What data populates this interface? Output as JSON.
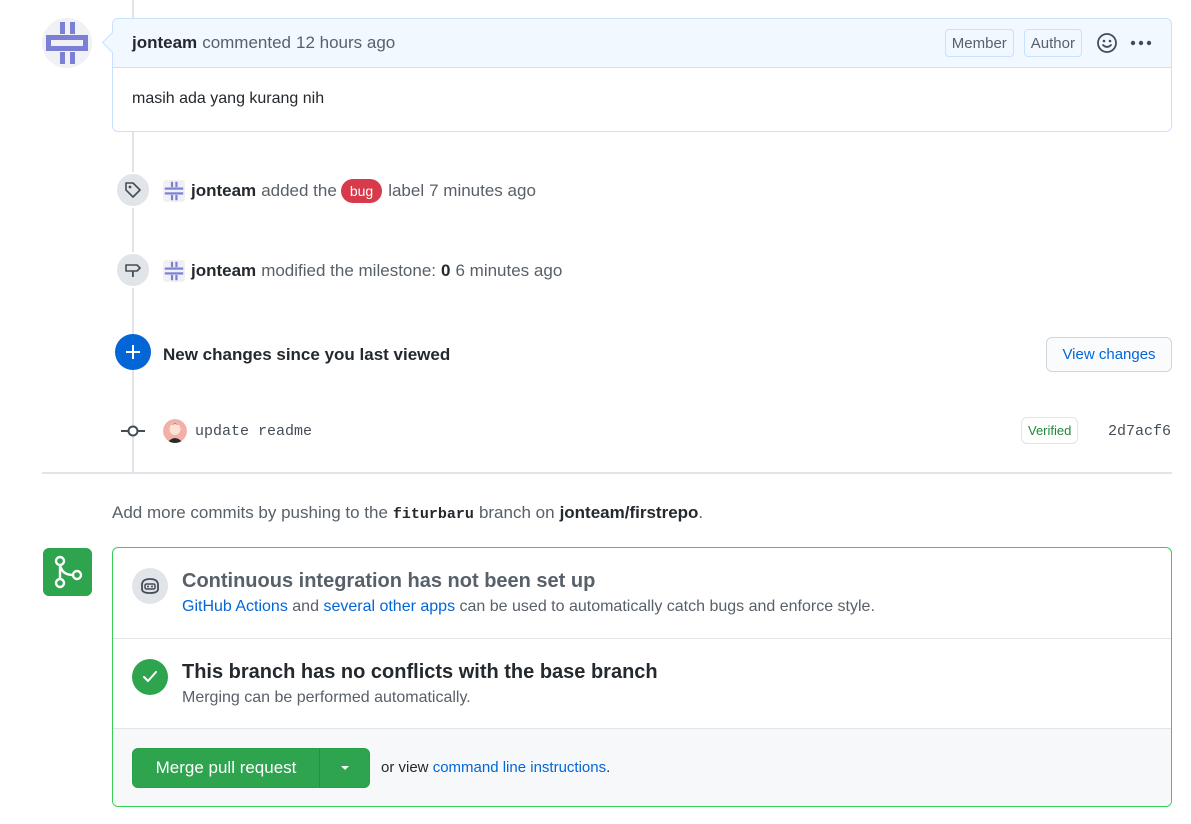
{
  "comment": {
    "author": "jonteam",
    "action": "commented",
    "time": "12 hours ago",
    "badges": [
      "Member",
      "Author"
    ],
    "body": "masih ada yang kurang nih"
  },
  "events": {
    "label_event": {
      "author": "jonteam",
      "before": "added the",
      "label": "bug",
      "label_color": "#d73a4a",
      "after": "label",
      "time": "7 minutes ago"
    },
    "milestone_event": {
      "author": "jonteam",
      "before": "modified the milestone:",
      "milestone": "0",
      "time": "6 minutes ago"
    }
  },
  "new_changes": {
    "text": "New changes since you last viewed",
    "button": "View changes"
  },
  "commit": {
    "message": "update readme",
    "verified": "Verified",
    "sha": "2d7acf6"
  },
  "push_note": {
    "prefix": "Add more commits by pushing to the",
    "branch": "fiturbaru",
    "middle": "branch on",
    "repo": "jonteam/firstrepo",
    "suffix": "."
  },
  "merge_box": {
    "ci": {
      "title": "Continuous integration has not been set up",
      "link1": "GitHub Actions",
      "and": "and",
      "link2": "several other apps",
      "rest": "can be used to automatically catch bugs and enforce style."
    },
    "conflicts": {
      "title": "This branch has no conflicts with the base branch",
      "subtitle": "Merging can be performed automatically."
    },
    "merge": {
      "button": "Merge pull request",
      "alt_prefix": "or view",
      "alt_link": "command line instructions",
      "alt_suffix": "."
    }
  },
  "colors": {
    "accent": "#0366d6",
    "success": "#2ea44f",
    "bug": "#d73a4a"
  }
}
